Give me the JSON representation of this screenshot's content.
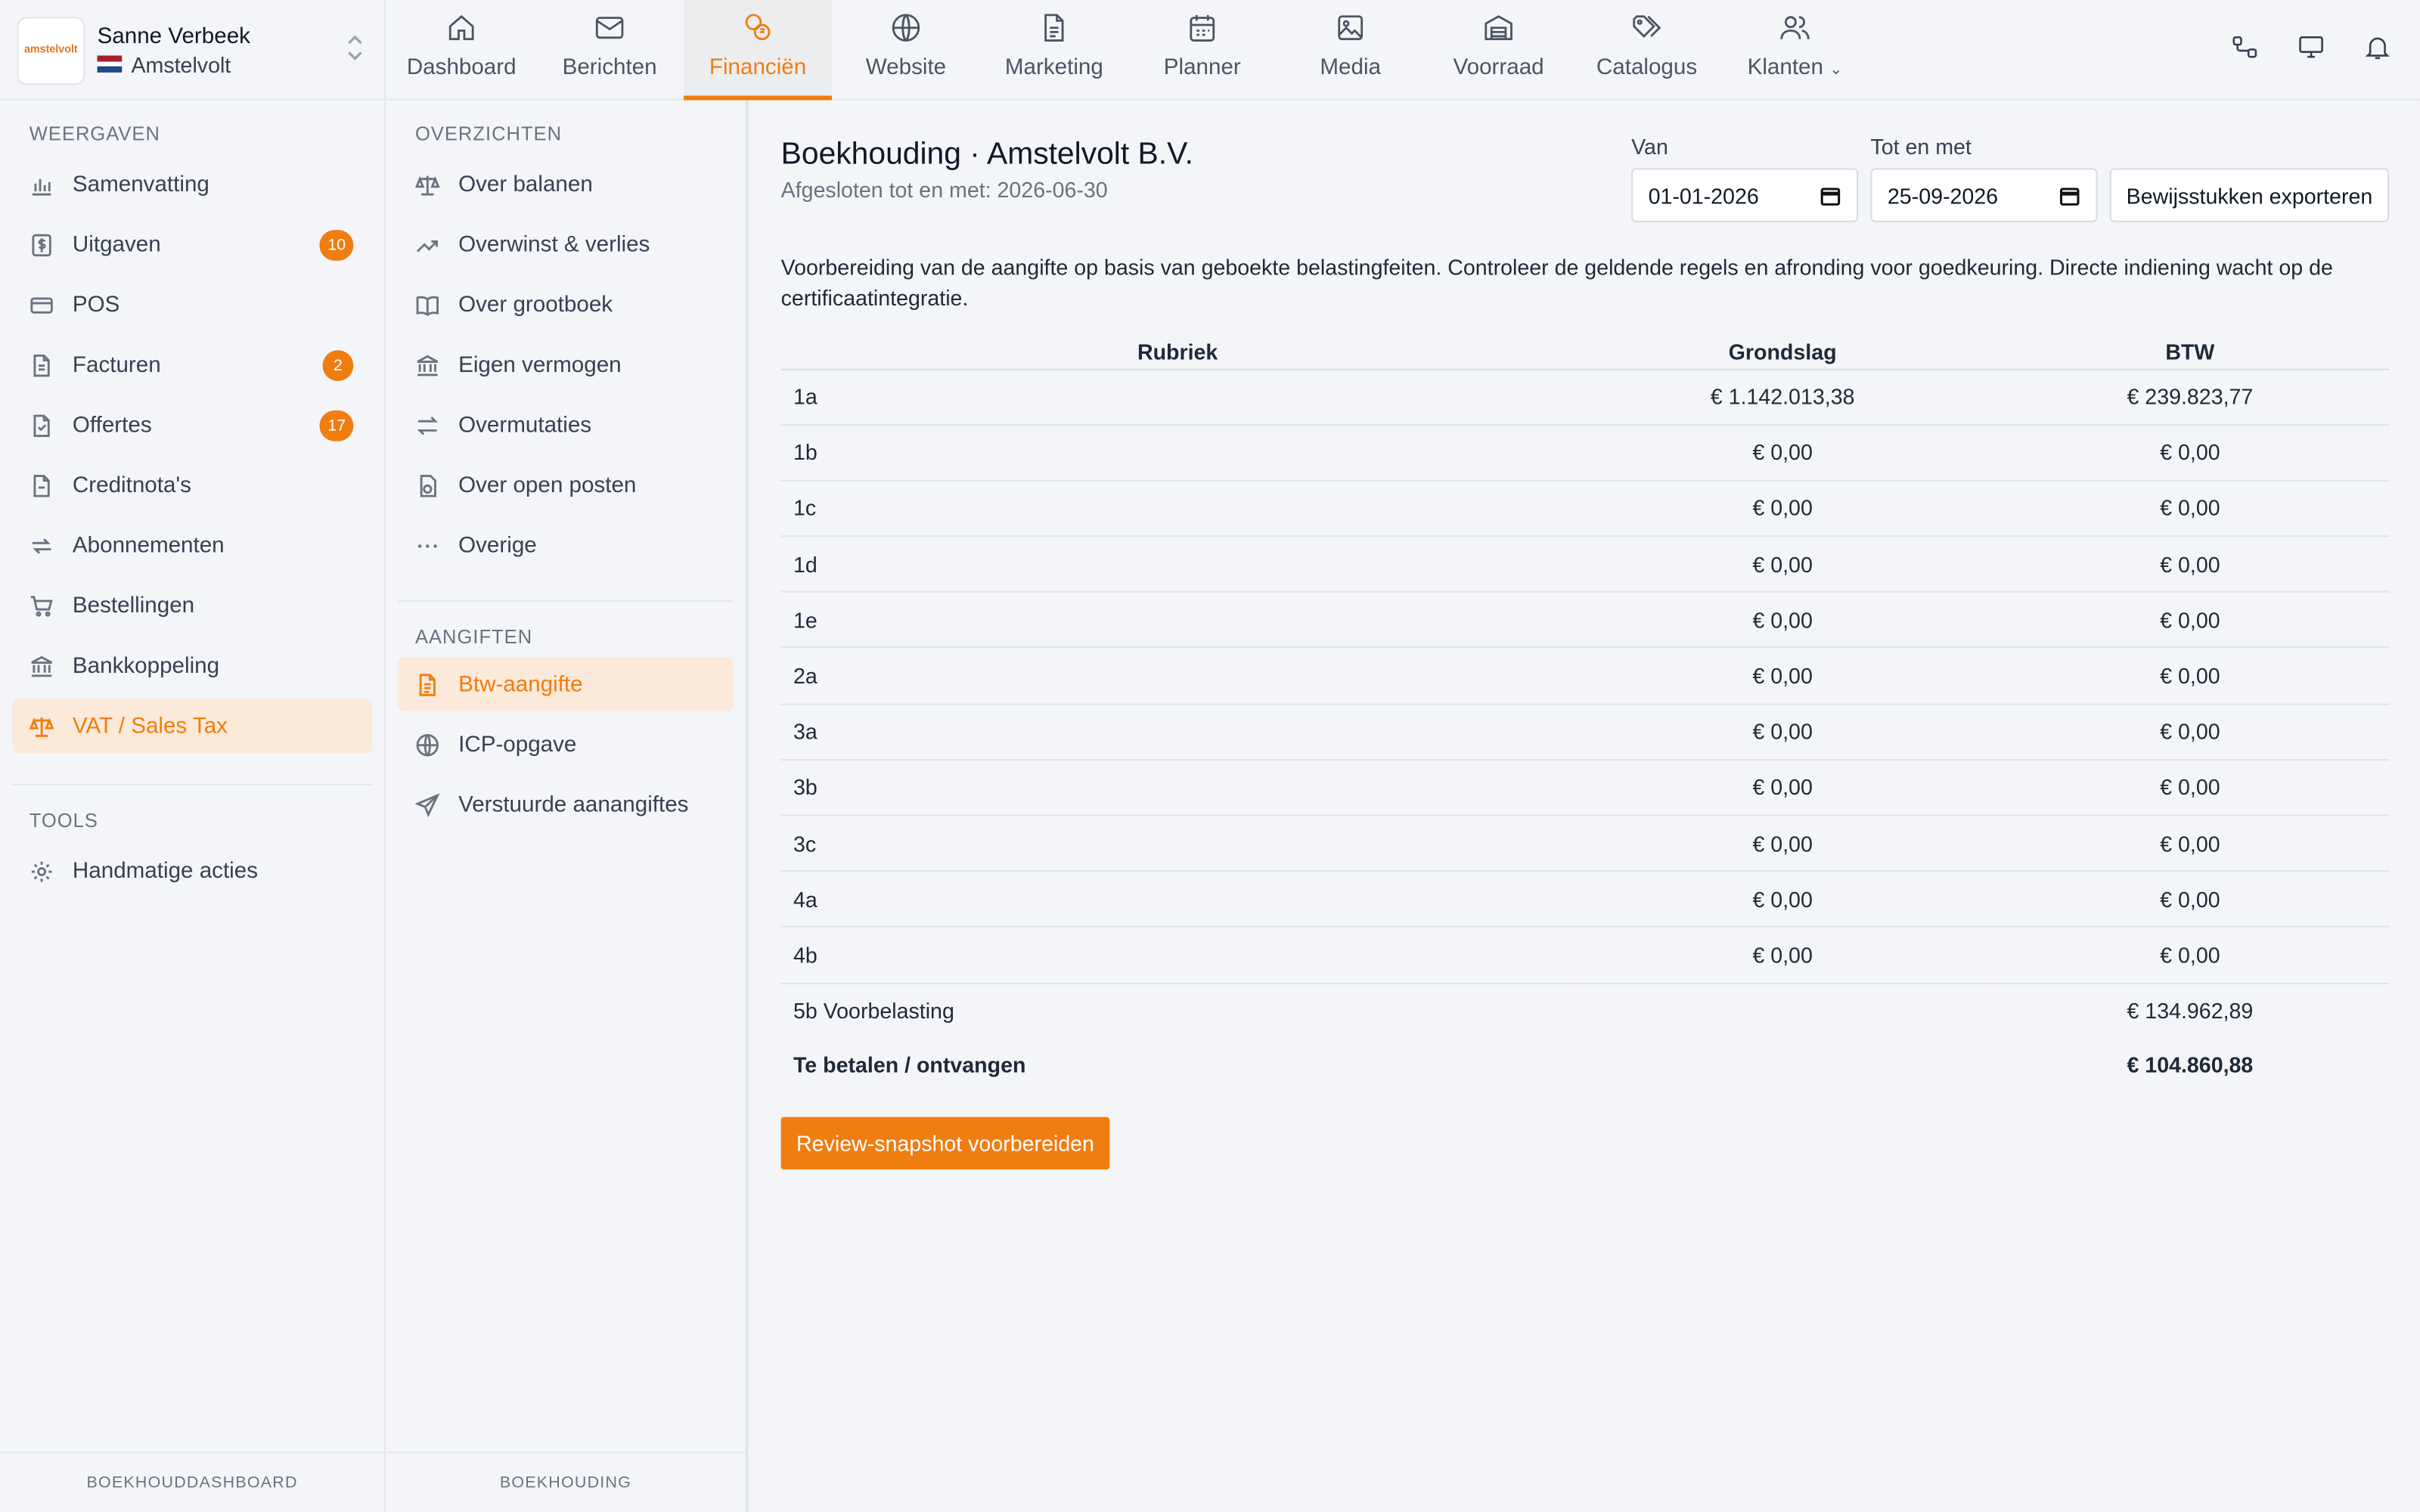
{
  "account": {
    "logo_text": "amstelvolt",
    "user_name": "Sanne Verbeek",
    "org_name": "Amstelvolt"
  },
  "nav": [
    {
      "label": "Dashboard",
      "icon": "home-icon"
    },
    {
      "label": "Berichten",
      "icon": "mail-icon"
    },
    {
      "label": "Financiën",
      "icon": "coins-icon",
      "active": true
    },
    {
      "label": "Website",
      "icon": "globe-icon"
    },
    {
      "label": "Marketing",
      "icon": "document-icon"
    },
    {
      "label": "Planner",
      "icon": "calendar-icon"
    },
    {
      "label": "Media",
      "icon": "image-icon"
    },
    {
      "label": "Voorraad",
      "icon": "warehouse-icon"
    },
    {
      "label": "Catalogus",
      "icon": "tags-icon"
    },
    {
      "label": "Klanten",
      "icon": "users-icon"
    }
  ],
  "sidebar": {
    "section_views": "WEERGAVEN",
    "items": [
      {
        "label": "Samenvatting",
        "icon": "bar-chart-icon"
      },
      {
        "label": "Uitgaven",
        "icon": "dollar-receipt-icon",
        "badge": "10"
      },
      {
        "label": "POS",
        "icon": "credit-card-icon"
      },
      {
        "label": "Facturen",
        "icon": "invoice-icon",
        "badge": "2"
      },
      {
        "label": "Offertes",
        "icon": "quote-icon",
        "badge": "17"
      },
      {
        "label": "Creditnota's",
        "icon": "credit-note-icon"
      },
      {
        "label": "Abonnementen",
        "icon": "repeat-icon"
      },
      {
        "label": "Bestellingen",
        "icon": "cart-icon"
      },
      {
        "label": "Bankkoppeling",
        "icon": "bank-icon"
      },
      {
        "label": "VAT / Sales Tax",
        "icon": "scale-icon",
        "active": true
      }
    ],
    "section_tools": "TOOLS",
    "tools": [
      {
        "label": "Handmatige acties",
        "icon": "gear-icon"
      }
    ],
    "footer": "BOEKHOUDDASHBOARD"
  },
  "subnav": {
    "section_overviews": "OVERZICHTEN",
    "overviews": [
      {
        "label": "Over balanen",
        "icon": "scale-icon"
      },
      {
        "label": "Overwinst & verlies",
        "icon": "trend-up-icon"
      },
      {
        "label": "Over grootboek",
        "icon": "book-icon"
      },
      {
        "label": "Eigen vermogen",
        "icon": "bank-icon"
      },
      {
        "label": "Overmutaties",
        "icon": "arrows-icon"
      },
      {
        "label": "Over open posten",
        "icon": "open-items-icon"
      },
      {
        "label": "Overige",
        "icon": "more-icon"
      }
    ],
    "section_filings": "AANGIFTEN",
    "filings": [
      {
        "label": "Btw-aangifte",
        "icon": "file-text-icon",
        "active": true
      },
      {
        "label": "ICP-opgave",
        "icon": "globe-icon"
      },
      {
        "label": "Verstuurde aanangiftes",
        "icon": "send-icon"
      }
    ],
    "footer": "BOEKHOUDING"
  },
  "main": {
    "title": "Boekhouding · Amstelvolt B.V.",
    "subtitle": "Afgesloten tot en met: 2026-06-30",
    "from_label": "Van",
    "from_value": "01-01-2026",
    "to_label": "Tot en met",
    "to_value": "25-09-2026",
    "export_button": "Bewijsstukken exporteren",
    "intro": "Voorbereiding van de aangifte op basis van geboekte belastingfeiten. Controleer de geldende regels en afronding voor goedkeuring. Directe indiening wacht op de certificaatintegratie.",
    "table": {
      "headers": [
        "Rubriek",
        "Grondslag",
        "BTW"
      ],
      "rows": [
        [
          "1a",
          "€ 1.142.013,38",
          "€ 239.823,77"
        ],
        [
          "1b",
          "€ 0,00",
          "€ 0,00"
        ],
        [
          "1c",
          "€ 0,00",
          "€ 0,00"
        ],
        [
          "1d",
          "€ 0,00",
          "€ 0,00"
        ],
        [
          "1e",
          "€ 0,00",
          "€ 0,00"
        ],
        [
          "2a",
          "€ 0,00",
          "€ 0,00"
        ],
        [
          "3a",
          "€ 0,00",
          "€ 0,00"
        ],
        [
          "3b",
          "€ 0,00",
          "€ 0,00"
        ],
        [
          "3c",
          "€ 0,00",
          "€ 0,00"
        ],
        [
          "4a",
          "€ 0,00",
          "€ 0,00"
        ],
        [
          "4b",
          "€ 0,00",
          "€ 0,00"
        ]
      ],
      "prepaid": [
        "5b Voorbelasting",
        "",
        "€ 134.962,89"
      ],
      "total": [
        "Te betalen / ontvangen",
        "",
        "€ 104.860,88"
      ]
    },
    "primary_button": "Review-snapshot voorbereiden"
  },
  "colors": {
    "accent": "#f07d10",
    "active_bg": "#fbe9d9",
    "background": "#f3f5f8"
  }
}
